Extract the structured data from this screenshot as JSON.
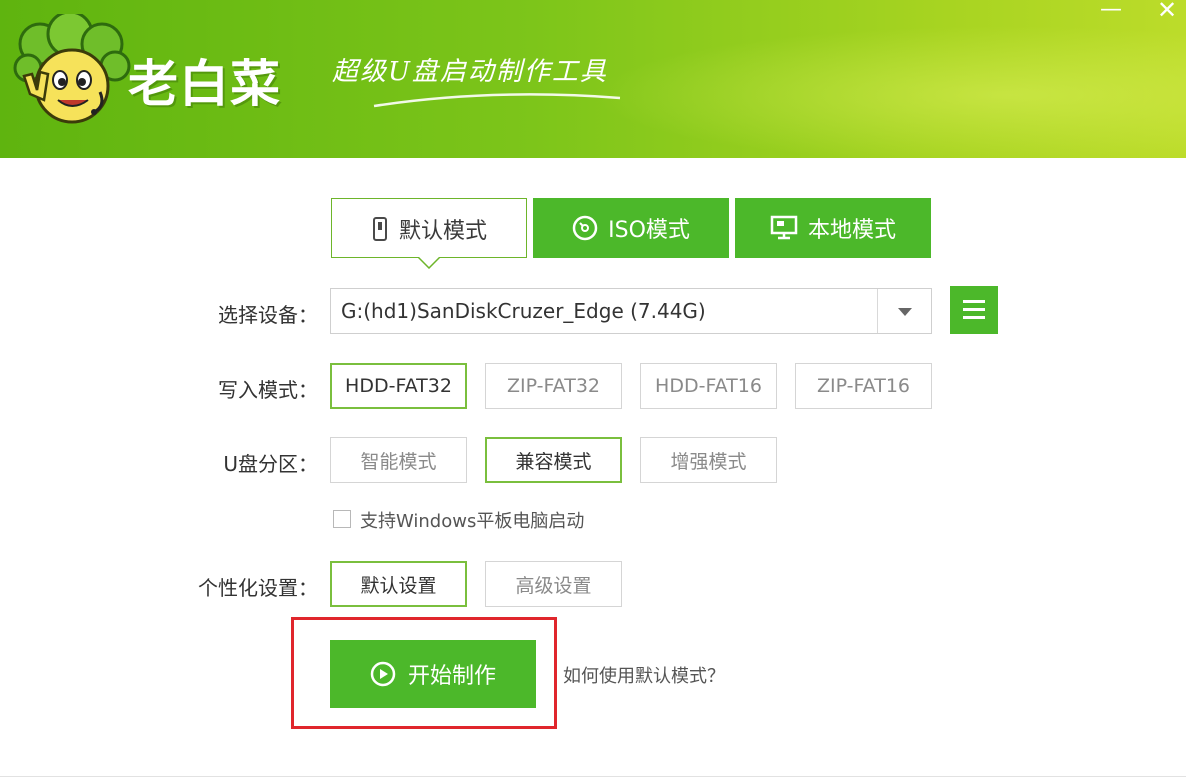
{
  "header": {
    "brand": "老白菜",
    "slogan": "超级U盘启动制作工具",
    "window_min": "—",
    "window_close": "✕"
  },
  "tabs": [
    {
      "label": "默认模式",
      "icon": "usb-drive-icon",
      "active": true
    },
    {
      "label": "ISO模式",
      "icon": "disc-icon",
      "active": false
    },
    {
      "label": "本地模式",
      "icon": "monitor-icon",
      "active": false
    }
  ],
  "device": {
    "label": "选择设备：",
    "value": "G:(hd1)SanDiskCruzer_Edge (7.44G)"
  },
  "write_mode": {
    "label": "写入模式：",
    "options": [
      "HDD-FAT32",
      "ZIP-FAT32",
      "HDD-FAT16",
      "ZIP-FAT16"
    ],
    "selected": "HDD-FAT32"
  },
  "partition": {
    "label": "U盘分区：",
    "options": [
      "智能模式",
      "兼容模式",
      "增强模式"
    ],
    "selected": "兼容模式"
  },
  "tablet_option": {
    "label": "支持Windows平板电脑启动",
    "checked": false
  },
  "personalize": {
    "label": "个性化设置：",
    "options": [
      "默认设置",
      "高级设置"
    ],
    "selected": "默认设置"
  },
  "start_button": {
    "label": "开始制作"
  },
  "help_link": "如何使用默认模式？",
  "colors": {
    "brand_green": "#4cb82a",
    "header_green": "#7dc51a",
    "highlight_red": "#e0262c",
    "selected_border": "#7abf3d"
  }
}
